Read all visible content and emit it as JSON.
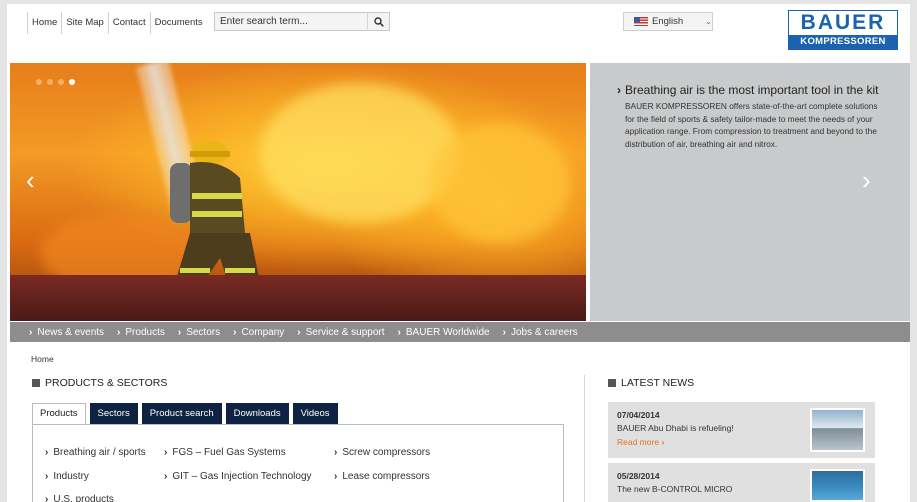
{
  "topnav": {
    "home": "Home",
    "sitemap": "Site Map",
    "contact": "Contact",
    "documents": "Documents"
  },
  "search": {
    "placeholder": "Enter search term..."
  },
  "language": {
    "selected": "English"
  },
  "logo": {
    "top": "BAUER",
    "bottom": "KOMPRESSOREN"
  },
  "hero": {
    "slides_total": 4,
    "active_slide": 4,
    "headline": "Breathing air is the most important tool in the kit",
    "body": "BAUER KOMPRESSOREN offers state-of-the-art complete solutions for the field of sports & safety tailor-made to meet the needs of your application range. From compression to treatment and beyond to the distribution of air, breathing air and nitrox."
  },
  "mainnav": [
    "News & events",
    "Products",
    "Sectors",
    "Company",
    "Service & support",
    "BAUER Worldwide",
    "Jobs & careers"
  ],
  "breadcrumb": "Home",
  "products_section": {
    "heading": "PRODUCTS & SECTORS",
    "tabs": [
      "Products",
      "Sectors",
      "Product search",
      "Downloads",
      "Videos"
    ],
    "active_tab": "Products",
    "links": {
      "col1": [
        "Breathing air / sports",
        "Industry",
        "U.S. products"
      ],
      "col2": [
        "FGS – Fuel Gas Systems",
        "GIT – Gas Injection Technology"
      ],
      "col3": [
        "Screw compressors",
        "Lease compressors"
      ]
    }
  },
  "news_section": {
    "heading": "LATEST NEWS",
    "items": [
      {
        "date": "07/04/2014",
        "title": "BAUER Abu Dhabi is refueling!",
        "more": "Read more"
      },
      {
        "date": "05/28/2014",
        "title": "The new B-CONTROL MICRO",
        "more": ""
      }
    ]
  },
  "colors": {
    "brand_blue": "#1b63ae",
    "nav_gray": "#8d8d8d",
    "tab_navy": "#0d2341",
    "accent_orange": "#e8731a"
  }
}
